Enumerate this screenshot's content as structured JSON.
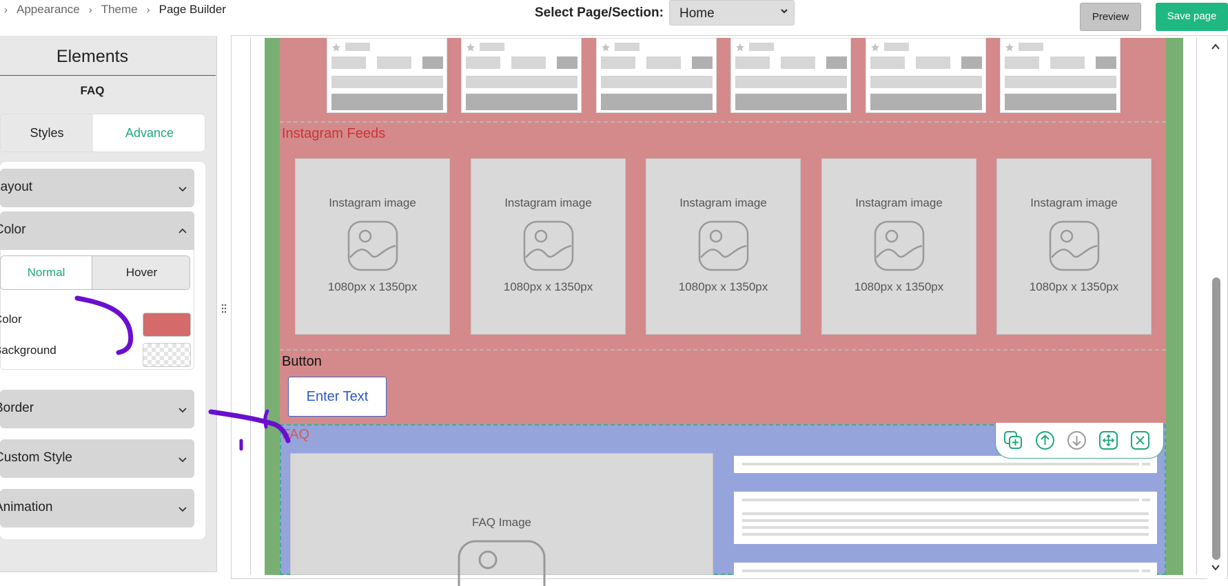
{
  "breadcrumb": {
    "items": [
      "Appearance",
      "Theme"
    ],
    "current": "Page Builder"
  },
  "header": {
    "select_label": "Select Page/Section:",
    "select_value": "Home",
    "preview_label": "Preview",
    "save_label": "Save page"
  },
  "panel": {
    "title": "Elements",
    "subtitle": "FAQ",
    "tabs": {
      "styles": "Styles",
      "advance": "Advance",
      "active": "Advance"
    },
    "accordions": {
      "layout": "Layout",
      "color": "Color",
      "border": "Border",
      "custom_style": "Custom Style",
      "animation": "Animation"
    },
    "color_tabs": {
      "normal": "Normal",
      "hover": "Hover",
      "active": "Normal"
    },
    "color_props": {
      "color_label": "Color",
      "background_label": "Background"
    }
  },
  "canvas": {
    "instagram": {
      "label": "Instagram Feeds",
      "cards": [
        {
          "title": "Instagram image",
          "size": "1080px x 1350px"
        },
        {
          "title": "Instagram image",
          "size": "1080px x 1350px"
        },
        {
          "title": "Instagram image",
          "size": "1080px x 1350px"
        },
        {
          "title": "Instagram image",
          "size": "1080px x 1350px"
        },
        {
          "title": "Instagram image",
          "size": "1080px x 1350px"
        }
      ]
    },
    "button_section": {
      "label": "Button",
      "button_text": "Enter Text"
    },
    "faq": {
      "label": "FAQ",
      "image_title": "FAQ Image"
    }
  },
  "colors": {
    "accent": "#1fb882",
    "section_red": "#d48a8a",
    "section_green": "#7aaf74",
    "section_blue": "#95a4db",
    "swatch_color": "#d46a6a",
    "annotation": "#6a0fd0"
  },
  "icons": [
    "chevron-right-icon",
    "chevron-down-icon",
    "chevron-up-icon",
    "star-icon",
    "image-placeholder-icon",
    "duplicate-icon",
    "move-up-icon",
    "move-down-icon",
    "move-icon",
    "delete-icon",
    "drag-handle-icon"
  ]
}
